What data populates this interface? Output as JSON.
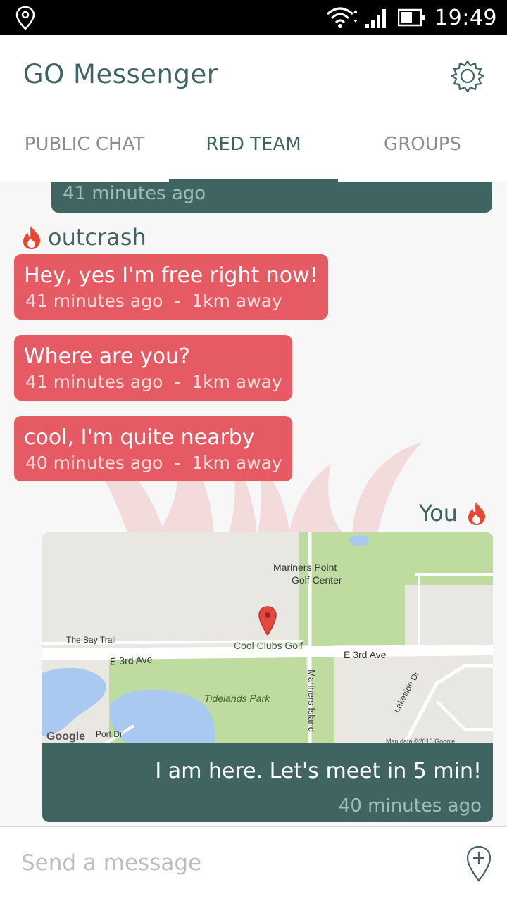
{
  "status_bar": {
    "time": "19:49",
    "icons": [
      "location-icon",
      "wifi-icon",
      "signal-icon",
      "battery-icon"
    ]
  },
  "app": {
    "title": "GO Messenger",
    "settings_icon": "gear-icon"
  },
  "tabs": [
    {
      "label": "PUBLIC CHAT",
      "active": false
    },
    {
      "label": "RED TEAM",
      "active": true
    },
    {
      "label": "GROUPS",
      "active": false
    }
  ],
  "chat": {
    "previous": {
      "time": "41 minutes ago"
    },
    "sender": {
      "name": "outcrash",
      "icon": "flame-icon"
    },
    "messages": [
      {
        "text": "Hey, yes I'm free right now!",
        "time": "41 minutes ago",
        "sep": "-",
        "distance": "1km away"
      },
      {
        "text": "Where are you?",
        "time": "41 minutes ago",
        "sep": "-",
        "distance": "1km away"
      },
      {
        "text": "cool, I'm quite nearby",
        "time": "40 minutes ago",
        "sep": "-",
        "distance": "1km away"
      }
    ],
    "me": {
      "name": "You",
      "icon": "flame-icon"
    },
    "map_message": {
      "caption": "I am here. Let's meet in 5 min!",
      "time": "40 minutes ago",
      "map_labels": {
        "golf_center": "Mariners Point",
        "golf_center2": "Golf Center",
        "bay_trail": "The Bay Trail",
        "cool_clubs": "Cool Clubs Golf",
        "e3rd_left": "E 3rd Ave",
        "e3rd_right": "E 3rd Ave",
        "tidelands": "Tidelands Park",
        "mariners_island": "Mariners Island",
        "lakeside": "Lakeside Dr",
        "port": "Port Dr",
        "google": "Google",
        "mapdata": "Map data ©2016 Google"
      }
    }
  },
  "composer": {
    "placeholder": "Send a message",
    "button_icon": "add-location-icon"
  },
  "colors": {
    "team_red": "#e55a63",
    "accent": "#3f6461",
    "own_bubble": "#406461"
  }
}
